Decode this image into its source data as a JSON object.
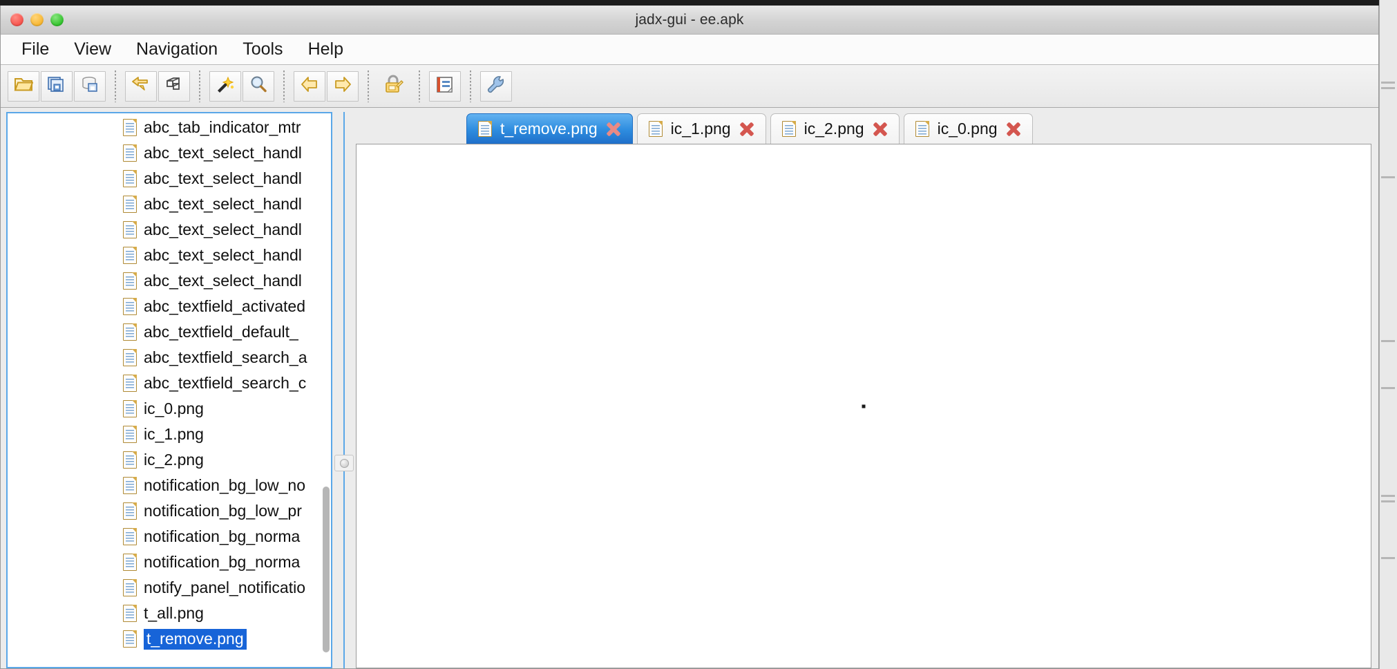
{
  "window": {
    "title": "jadx-gui - ee.apk",
    "controls": [
      {
        "name": "close",
        "icon": "close-traffic-light"
      },
      {
        "name": "minimize",
        "icon": "minimize-traffic-light"
      },
      {
        "name": "maximize",
        "icon": "maximize-traffic-light"
      }
    ]
  },
  "menubar": {
    "items": [
      {
        "label": "File"
      },
      {
        "label": "View"
      },
      {
        "label": "Navigation"
      },
      {
        "label": "Tools"
      },
      {
        "label": "Help"
      }
    ]
  },
  "toolbar": {
    "groups": [
      {
        "buttons": [
          {
            "name": "open-file-button",
            "icon": "open-folder-icon"
          },
          {
            "name": "save-all-button",
            "icon": "save-all-icon"
          },
          {
            "name": "export-gradle-button",
            "icon": "export-disk-icon"
          }
        ]
      },
      {
        "buttons": [
          {
            "name": "sync-button",
            "icon": "sync-arrow-icon"
          },
          {
            "name": "flat-packages-button",
            "icon": "grid-structure-icon"
          }
        ]
      },
      {
        "buttons": [
          {
            "name": "deobfuscation-button",
            "icon": "magic-wand-icon"
          },
          {
            "name": "search-button",
            "icon": "magnifier-icon"
          }
        ]
      },
      {
        "buttons": [
          {
            "name": "back-button",
            "icon": "arrow-left-icon"
          },
          {
            "name": "forward-button",
            "icon": "arrow-right-icon"
          }
        ]
      },
      {
        "buttons": [
          {
            "name": "decompile-button",
            "icon": "lock-pencil-icon"
          }
        ]
      },
      {
        "buttons": [
          {
            "name": "log-button",
            "icon": "notebook-icon"
          }
        ]
      },
      {
        "buttons": [
          {
            "name": "preferences-button",
            "icon": "wrench-icon"
          }
        ]
      }
    ]
  },
  "tree": {
    "selected": "t_remove.png",
    "items": [
      {
        "label": "abc_tab_indicator_mtr",
        "icon": "file-icon"
      },
      {
        "label": "abc_text_select_handl",
        "icon": "file-icon"
      },
      {
        "label": "abc_text_select_handl",
        "icon": "file-icon"
      },
      {
        "label": "abc_text_select_handl",
        "icon": "file-icon"
      },
      {
        "label": "abc_text_select_handl",
        "icon": "file-icon"
      },
      {
        "label": "abc_text_select_handl",
        "icon": "file-icon"
      },
      {
        "label": "abc_text_select_handl",
        "icon": "file-icon"
      },
      {
        "label": "abc_textfield_activated",
        "icon": "file-icon"
      },
      {
        "label": "abc_textfield_default_",
        "icon": "file-icon"
      },
      {
        "label": "abc_textfield_search_a",
        "icon": "file-icon"
      },
      {
        "label": "abc_textfield_search_c",
        "icon": "file-icon"
      },
      {
        "label": "ic_0.png",
        "icon": "file-icon"
      },
      {
        "label": "ic_1.png",
        "icon": "file-icon"
      },
      {
        "label": "ic_2.png",
        "icon": "file-icon"
      },
      {
        "label": "notification_bg_low_no",
        "icon": "file-icon"
      },
      {
        "label": "notification_bg_low_pr",
        "icon": "file-icon"
      },
      {
        "label": "notification_bg_norma",
        "icon": "file-icon"
      },
      {
        "label": "notification_bg_norma",
        "icon": "file-icon"
      },
      {
        "label": "notify_panel_notificatio",
        "icon": "file-icon"
      },
      {
        "label": "t_all.png",
        "icon": "file-icon"
      },
      {
        "label": "t_remove.png",
        "icon": "file-icon",
        "selected": true
      }
    ]
  },
  "tabs": [
    {
      "label": "t_remove.png",
      "icon": "file-icon",
      "active": true,
      "close_icon": "close-x-icon"
    },
    {
      "label": "ic_1.png",
      "icon": "file-icon",
      "active": false,
      "close_icon": "close-x-icon"
    },
    {
      "label": "ic_2.png",
      "icon": "file-icon",
      "active": false,
      "close_icon": "close-x-icon"
    },
    {
      "label": "ic_0.png",
      "icon": "file-icon",
      "active": false,
      "close_icon": "close-x-icon"
    }
  ],
  "colors": {
    "accent_selection": "#1764d8",
    "tab_active": "#2f8ee0",
    "pane_focus_border": "#5aa7e8",
    "close_x": "#d4564f",
    "file_icon_border": "#b08a34"
  }
}
